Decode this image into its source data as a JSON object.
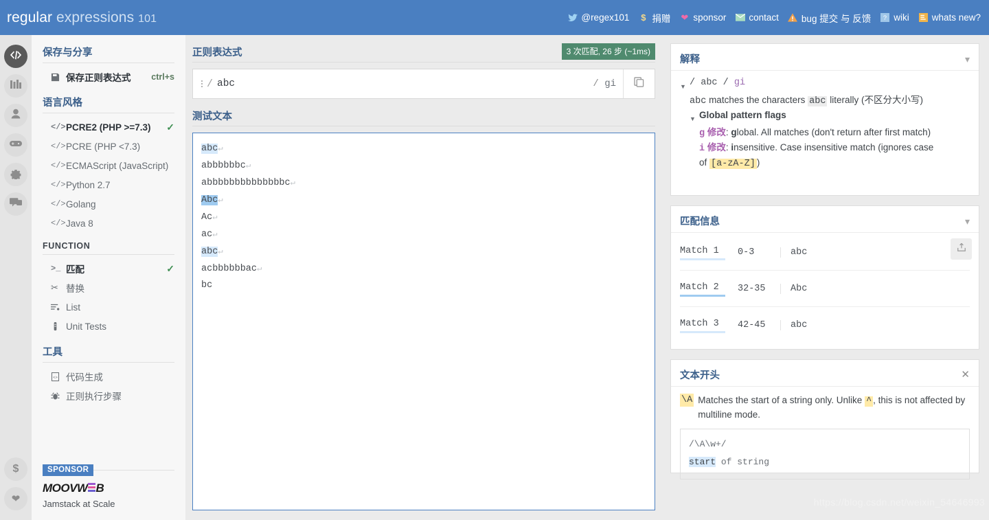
{
  "header": {
    "logo": {
      "part1": "regular",
      "part2": "expressions",
      "part3": "101"
    },
    "nav": [
      {
        "icon": "twitter-icon",
        "label": "@regex101"
      },
      {
        "icon": "dollar-icon",
        "label": "捐赠"
      },
      {
        "icon": "heart-icon",
        "label": "sponsor"
      },
      {
        "icon": "mail-icon",
        "label": "contact"
      },
      {
        "icon": "warning-icon",
        "label": "bug 提交 与 反馈"
      },
      {
        "icon": "book-icon",
        "label": "wiki"
      },
      {
        "icon": "news-icon",
        "label": "whats new?"
      }
    ]
  },
  "rail": {
    "top": [
      "code-icon",
      "library-icon",
      "account-icon",
      "gamepad-icon",
      "gear-icon",
      "community-icon"
    ],
    "bottom": [
      "dollar-icon",
      "heart-icon"
    ]
  },
  "sidebar": {
    "save_section": {
      "title": "保存与分享",
      "item_label": "保存正则表达式",
      "shortcut": "ctrl+s",
      "icon": "save-icon"
    },
    "flavor_section": {
      "title": "语言风格",
      "items": [
        {
          "label": "PCRE2 (PHP >=7.3)",
          "selected": true
        },
        {
          "label": "PCRE (PHP <7.3)",
          "selected": false
        },
        {
          "label": "ECMAScript (JavaScript)",
          "selected": false
        },
        {
          "label": "Python 2.7",
          "selected": false
        },
        {
          "label": "Golang",
          "selected": false
        },
        {
          "label": "Java 8",
          "selected": false
        }
      ]
    },
    "function_section": {
      "title": "FUNCTION",
      "items": [
        {
          "label": "匹配",
          "icon": "terminal-icon",
          "selected": true
        },
        {
          "label": "替换",
          "icon": "scissors-icon",
          "selected": false
        },
        {
          "label": "List",
          "icon": "list-icon",
          "selected": false
        },
        {
          "label": "Unit Tests",
          "icon": "test-tube-icon",
          "selected": false
        }
      ]
    },
    "tools_section": {
      "title": "工具",
      "items": [
        {
          "label": "代码生成",
          "icon": "code-file-icon"
        },
        {
          "label": "正则执行步骤",
          "icon": "debugger-icon"
        }
      ]
    },
    "sponsor": {
      "badge": "SPONSOR",
      "name_a": "MOOVW",
      "name_e": "E",
      "name_b": "B",
      "tagline": "Jamstack at Scale"
    }
  },
  "regex_panel": {
    "title": "正则表达式",
    "match_badge": "3 次匹配, 26 步 (~1ms)",
    "delimiter": "/",
    "pattern": "abc",
    "flags_slash": "/",
    "flags": "gi",
    "copy_icon": "copy-icon"
  },
  "test_panel": {
    "title": "测试文本",
    "lines": [
      {
        "text": "abc",
        "highlight": "light",
        "newline": true
      },
      {
        "text": "abbbbbbc",
        "highlight": "none",
        "newline": true
      },
      {
        "text": "abbbbbbbbbbbbbbc",
        "highlight": "none",
        "newline": true
      },
      {
        "text": "Abc",
        "highlight": "dark",
        "newline": true
      },
      {
        "text": "Ac",
        "highlight": "none",
        "newline": true
      },
      {
        "text": "ac",
        "highlight": "none",
        "newline": true
      },
      {
        "text": "abc",
        "highlight": "light",
        "newline": true
      },
      {
        "text": "acbbbbbbac",
        "highlight": "none",
        "newline": true
      },
      {
        "text": "bc",
        "highlight": "none",
        "newline": false
      }
    ],
    "return_glyph": "↵"
  },
  "explanation": {
    "title": "解释",
    "collapse_icon": "chevron-down-icon",
    "pattern_line": {
      "open": "/",
      "pattern": "abc",
      "close": "/",
      "flags": "gi"
    },
    "literal_line": {
      "pre": "abc",
      "mid": " matches the characters ",
      "token": "abc",
      "post": " literally (不区分大小写)"
    },
    "flags_title": "Global pattern flags",
    "flag_rows": [
      {
        "name": "g",
        "mod": "修改",
        "sep": ":",
        "bold": "g",
        "text": "lobal. All matches (don't return after first match)"
      },
      {
        "name": "i",
        "mod": "修改",
        "sep": ":",
        "bold": "i",
        "text": "nsensitive. Case insensitive match (ignores case"
      }
    ],
    "flag_tail_pre": "of ",
    "flag_tail_token": "[a-zA-Z]",
    "flag_tail_post": ")"
  },
  "match_info": {
    "title": "匹配信息",
    "collapse_icon": "chevron-down-icon",
    "export_icon": "export-icon",
    "matches": [
      {
        "name": "Match 1",
        "range": "0-3",
        "value": "abc",
        "underline": "light"
      },
      {
        "name": "Match 2",
        "range": "32-35",
        "value": "Abc",
        "underline": "dark"
      },
      {
        "name": "Match 3",
        "range": "42-45",
        "value": "abc",
        "underline": "light"
      }
    ]
  },
  "quick_reference": {
    "title": "文本开头",
    "close_icon": "close-icon",
    "token": "\\A",
    "desc_pre": "Matches the start of a string only. Unlike ",
    "desc_token": "^",
    "desc_post": ", this is not affected by multiline mode.",
    "example_pattern": "/\\A\\w+/",
    "example_hl": "start",
    "example_rest": " of string"
  },
  "watermark": "https://blog.csdn.net/weixin_54646993"
}
